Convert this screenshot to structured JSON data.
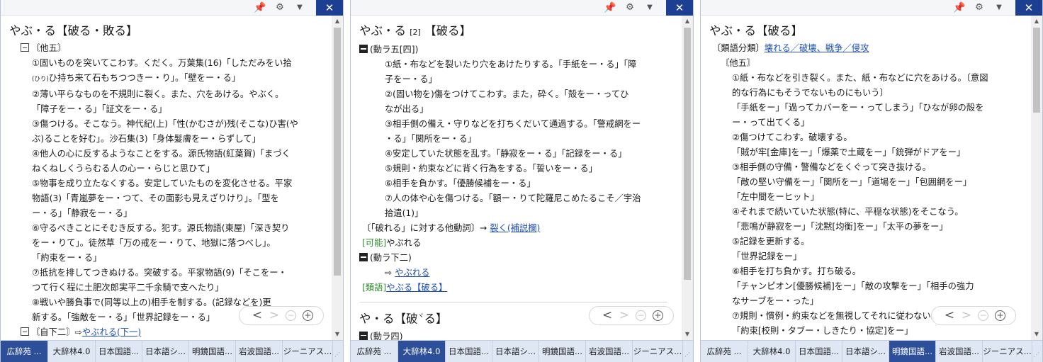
{
  "tabs": [
    "広辞苑 ...",
    "大辞林4.0",
    "日本国語...",
    "日本語シ...",
    "明鏡国語...",
    "岩波国語...",
    "ジーニアス..."
  ],
  "panel0": {
    "headword": "やぶ・る【破る・敗る】",
    "lines": [
      {
        "cls": "l1",
        "box": "minus",
        "text": "〘他五〙"
      },
      {
        "cls": "l2",
        "text": "①固いものを突いてこわす。くだく。万葉集(16)「しただみをい拾"
      },
      {
        "cls": "l2c",
        "ruby": "(ひり)",
        "text": "ひ持ち来て石もちつつきー・り」。「壁をー・る」"
      },
      {
        "cls": "l2",
        "text": "②薄い平らなものを不規則に裂く。また、穴をあける。やぶく。"
      },
      {
        "cls": "l2c",
        "text": "「障子をー・る」「証文をー・る」"
      },
      {
        "cls": "l2",
        "text": "③傷つける。そこなう。神代紀(上)「性(かむさが)残(そこな)ひ害(や"
      },
      {
        "cls": "l2c",
        "text": "ぶ)ることを好む」。沙石集(3)「身体髮膚をー・らずして」"
      },
      {
        "cls": "l2",
        "text": "④他人の心に反するようなことをする。源氏物語(紅葉賀)「まづく"
      },
      {
        "cls": "l2c",
        "text": "ねくねしくうらむる人の心ー・らじと思ひて」"
      },
      {
        "cls": "l2",
        "text": "⑤物事を成り立たなくする。安定していたものを変化させる。平家"
      },
      {
        "cls": "l2c",
        "text": "物語(3)「青嵐夢をー・つて、その面影も見えざりけり」。「型を"
      },
      {
        "cls": "l2c",
        "text": "ー・る」「静寂をー・る」"
      },
      {
        "cls": "l2",
        "text": "⑥守るべきことにそむき反する。犯す。源氏物語(東屋)「深き契り"
      },
      {
        "cls": "l2c",
        "text": "をー・りて」。徒然草「万の戒をー・りて、地獄に落つべし」。"
      },
      {
        "cls": "l2c",
        "text": "「約束をー・る」"
      },
      {
        "cls": "l2",
        "text": "⑦抵抗を排してつきぬける。突破する。平家物語(9)「そこをー・"
      },
      {
        "cls": "l2c",
        "text": "つて行く程に土肥次郎実平二千余騎で支へたり」"
      },
      {
        "cls": "l2",
        "text": "⑧戦いや勝負事で(同等以上の)相手を制する。(記録などを)更"
      },
      {
        "cls": "l2c",
        "text": "新する。「強敵をー・る」「世界記録をー・る」"
      },
      {
        "cls": "l1",
        "box": "minus",
        "text": "〘自下二〙⇨",
        "link": "やぶれる(下一)"
      }
    ]
  },
  "panel1": {
    "headword": "やぶ・る",
    "headword_num": "[2]",
    "headword_kanji": "【破る】",
    "lines": [
      {
        "cls": "",
        "box": "filled",
        "text": "(動ラ五[四])"
      },
      {
        "cls": "l3",
        "text": "①紙・布などを裂いたり穴をあけたりする。「手紙をー・る」「障"
      },
      {
        "cls": "l3c",
        "text": "子をー・る」"
      },
      {
        "cls": "l3",
        "text": "②(固い物を)傷をつけてこわす。また，砕く。「殻をー・ってひ"
      },
      {
        "cls": "l3c",
        "text": "なが出る」"
      },
      {
        "cls": "l3",
        "text": "③相手側の備え・守りなどを打ちくだいて通過する。「警戒網をー"
      },
      {
        "cls": "l3c",
        "text": "・る」「関所をー・る」"
      },
      {
        "cls": "l3",
        "text": "④安定していた状態を乱す。「静寂をー・る」「記録をー・る」"
      },
      {
        "cls": "l3",
        "text": "⑤規則・約束などに背く行為をする。「誓いをー・る」"
      },
      {
        "cls": "l3",
        "text": "⑥相手を負かす。「優勝候補をー・る」"
      },
      {
        "cls": "l3",
        "text": "⑦人の体や心を傷つける。「額ー・りて陀羅尼こめたるこそ／宇治"
      },
      {
        "cls": "l3c",
        "text": "拾遺(1)」"
      },
      {
        "cls": "l0s",
        "text": "〔「破れる」に対する他動詞〕→ ",
        "link": "裂く(補説欄)"
      },
      {
        "cls": "l0s",
        "tag": "[可能]",
        "text": "やぶれる"
      },
      {
        "cls": "",
        "box": "filled",
        "text": "(動ラ下二)"
      },
      {
        "cls": "l3",
        "text": "⇨ ",
        "link": "やぶれる"
      },
      {
        "cls": "l0s",
        "tag": "[類語]",
        "link": "やぶる【破る】"
      }
    ],
    "headword2": "や・る【破",
    "headword2_tail": "る】",
    "headword2_mark": "ヾ",
    "line_last": "(動ラ四)"
  },
  "panel2": {
    "headword": "やぶ・る【破る】",
    "lines": [
      {
        "cls": "l0s",
        "text": "〔類語分類〕",
        "link": "壊れる／破壊、戦争／侵攻"
      },
      {
        "cls": "l1",
        "text": "〘他五〙"
      },
      {
        "cls": "l2",
        "text": "①紙・布などを引き裂く。また、紙・布などに穴をあける。〔意図"
      },
      {
        "cls": "l2c",
        "text": "的な行為にもそうでないものにもいう〕"
      },
      {
        "cls": "l2c",
        "text": "「手紙をー」「過ってカバーをー・ってしまう」「ひなが卵の殻を"
      },
      {
        "cls": "l2c",
        "text": "ー・って出てくる」"
      },
      {
        "cls": "l2",
        "text": "②傷つけてこわす。破壊する。"
      },
      {
        "cls": "l2c",
        "text": "「賊が牢[金庫]をー」「爆薬で土蔵をー」「銃弾がドアをー」"
      },
      {
        "cls": "l2",
        "text": "③相手側の守備・警備などをくぐって突き抜ける。"
      },
      {
        "cls": "l2c",
        "text": "「敵の堅い守備をー」「関所をー」「道場をー」「包囲網をー」"
      },
      {
        "cls": "l2c",
        "text": "「左中間をーヒット」"
      },
      {
        "cls": "l2",
        "text": "④それまで続いていた状態(特に、平穏な状態)をそこなう。"
      },
      {
        "cls": "l2c",
        "text": "「悲鳴が静寂をー」「沈黙[均衡]をー」「太平の夢をー」"
      },
      {
        "cls": "l2",
        "text": "⑤記録を更新する。"
      },
      {
        "cls": "l2c",
        "text": "「世界記録をー」"
      },
      {
        "cls": "l2",
        "text": "⑥相手を打ち負かす。打ち破る。"
      },
      {
        "cls": "l2c",
        "text": "「チャンピオン[優勝候補]をー」「敵の攻撃をー」「相手の強力"
      },
      {
        "cls": "l2c",
        "text": "なサーブをー・った」"
      },
      {
        "cls": "l2",
        "text": "⑦規則・慣例・約束などを無視してそれに従わない。"
      },
      {
        "cls": "l2c",
        "text": "「約束[校則・タブー・しきたり・協定]をー」"
      }
    ]
  },
  "nav": {
    "prev": "<",
    "next": ">",
    "minus": "−",
    "plus": "+"
  },
  "titlebar": {
    "close": "✕"
  }
}
